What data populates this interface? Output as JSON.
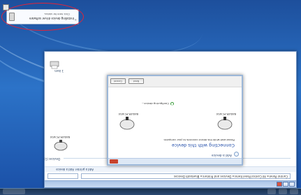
{
  "taskbar": {
    "buttons": [
      "",
      "",
      "",
      ""
    ]
  },
  "window": {
    "title": "",
    "address": "Control Panel  ▸  All Control Panel Items  ▸  Devices and Printers  ▸  Bluetooth Devices",
    "command_bar": {
      "add_device": "Add a device",
      "add_printer": "Add a printer"
    },
    "groups": {
      "devices": "Devices (1)",
      "printers": "Printers (1)"
    },
    "device_label": "BASLER-PC-W10",
    "printer_label": "1 item"
  },
  "dialog": {
    "heading": "Add a device",
    "title": "Connecting with this device",
    "description": "Please wait while this device connects to your computer.",
    "status": "Configuring device...",
    "device_left": "BASLER-PC-W10",
    "device_right": "BASLER-PC-W10",
    "buttons": {
      "next": "Next",
      "cancel": "Cancel"
    }
  },
  "notification": {
    "title": "Installing device driver software",
    "subtitle": "Click here for status.",
    "close": "×"
  },
  "colors": {
    "highlight": "#e0243a",
    "dialog_title": "#1d4aa8",
    "desktop": "#2c73c8"
  },
  "icons": [
    "computer-icon",
    "printer-icon",
    "back-arrow-icon",
    "spinner-icon",
    "usb-device-icon",
    "close-icon"
  ]
}
